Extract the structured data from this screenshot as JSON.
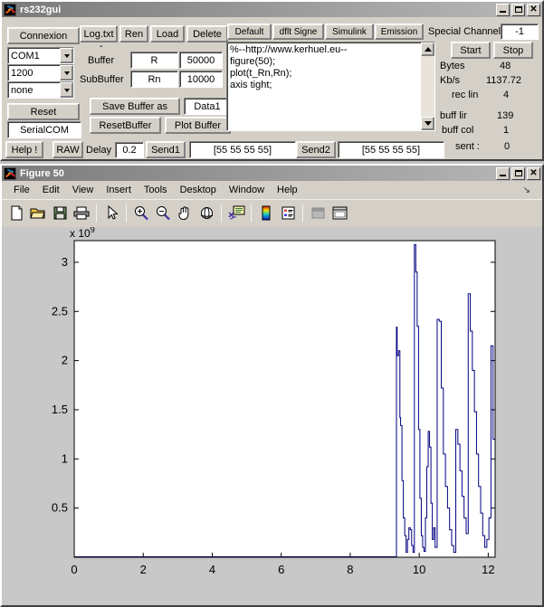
{
  "rs232": {
    "title": "rs232gui",
    "window_buttons": [
      "minimize",
      "maximize",
      "close"
    ],
    "connexion_button": "Connexion",
    "port_select": "COM1",
    "baud_select": "1200",
    "parity_select": "none",
    "reset_button": "Reset",
    "serial_name_field": "SerialCOM",
    "help_button": "Help !",
    "raw_button": "RAW",
    "delay_label": "Delay",
    "delay_value": "0.2",
    "log_button": "Log.txt",
    "ren_button": "Ren",
    "load_button": "Load",
    "delete_button": "Delete",
    "dash_label": "-",
    "buffer_label": "Buffer",
    "buffer_name": "R",
    "buffer_size": "50000",
    "subbuffer_label": "SubBuffer",
    "subbuffer_name": "Rn",
    "subbuffer_size": "10000",
    "save_buffer_button": "Save Buffer as",
    "save_buffer_name": "Data1",
    "reset_buffer_button": "ResetBuffer",
    "plot_buffer_button": "Plot Buffer",
    "send1_button": "Send1",
    "send1_value": "[55 55 55 55]",
    "send2_button": "Send2",
    "send2_value": "[55 55 55 55]",
    "default_button": "Default",
    "dflt_signe_button": "dflt Signe",
    "simulink_button": "Simulink",
    "emission_button": "Emission",
    "special_channel_label": "Special Channel",
    "special_channel_value": "-1",
    "code_lines": [
      "%--http://www.kerhuel.eu--",
      "figure(50);",
      "plot(t_Rn,Rn);",
      "axis tight;"
    ],
    "start_button": "Start",
    "stop_button": "Stop",
    "stats": [
      {
        "label": "Bytes",
        "value": "48"
      },
      {
        "label": "Kb/s",
        "value": "1137.72"
      },
      {
        "label": "rec lin",
        "value": "4"
      },
      {
        "label": "buff lir",
        "value": "139"
      },
      {
        "label": "buff col",
        "value": "1"
      },
      {
        "label": "sent :",
        "value": "0"
      }
    ]
  },
  "figure": {
    "title": "Figure 50",
    "menus": [
      "File",
      "Edit",
      "View",
      "Insert",
      "Tools",
      "Desktop",
      "Window",
      "Help"
    ],
    "toolbar_icons": [
      "new-figure-icon",
      "open-file-icon",
      "save-figure-icon",
      "print-figure-icon",
      "edit-plot-arrow-icon",
      "zoom-in-icon",
      "zoom-out-icon",
      "pan-icon",
      "rotate-3d-icon",
      "insert-colorbar-data-cursor-icon",
      "colorbar-icon",
      "legend-icon",
      "hide-plot-tools-icon",
      "show-plot-tools-icon"
    ],
    "dock_arrow": "dock-arrow-icon"
  },
  "chart_data": {
    "type": "line",
    "title": "",
    "xlabel": "",
    "ylabel": "",
    "y_exponent_label": "x 10",
    "y_exponent_sup": "9",
    "xlim": [
      0,
      12.2
    ],
    "ylim": [
      0,
      3.22
    ],
    "xticks": [
      0,
      2,
      4,
      6,
      8,
      10,
      12
    ],
    "xticklabels": [
      "0",
      "2",
      "4",
      "6",
      "8",
      "10",
      "12"
    ],
    "yticks": [
      0.5,
      1,
      1.5,
      2,
      2.5,
      3
    ],
    "yticklabels": [
      "0.5",
      "1",
      "1.5",
      "2",
      "2.5",
      "3"
    ],
    "grid": false,
    "legend": null,
    "line_color": "#000080",
    "series": [
      {
        "name": "Rn",
        "x": [
          0,
          9.32,
          9.34,
          9.36,
          9.4,
          9.44,
          9.46,
          9.5,
          9.54,
          9.58,
          9.62,
          9.66,
          9.7,
          9.74,
          9.78,
          9.82,
          9.86,
          9.9,
          9.94,
          9.98,
          10.02,
          10.06,
          10.1,
          10.14,
          10.18,
          10.22,
          10.26,
          10.3,
          10.34,
          10.38,
          10.42,
          10.46,
          10.52,
          10.58,
          10.64,
          10.7,
          10.76,
          10.82,
          10.88,
          10.94,
          11.0,
          11.06,
          11.12,
          11.18,
          11.24,
          11.3,
          11.36,
          11.42,
          11.48,
          11.54,
          11.6,
          11.66,
          11.72,
          11.78,
          11.84,
          11.9,
          11.96,
          12.02,
          12.08,
          12.14,
          12.2
        ],
        "y": [
          0.005,
          0.005,
          2.34,
          2.05,
          2.1,
          1.42,
          1.34,
          0.78,
          0.4,
          0.22,
          0.05,
          0.18,
          0.3,
          0.28,
          0.12,
          0.05,
          3.18,
          2.9,
          2.35,
          1.3,
          0.6,
          0.22,
          0.1,
          0.06,
          0.4,
          0.92,
          1.28,
          1.12,
          0.55,
          0.18,
          0.3,
          0.1,
          2.42,
          2.4,
          1.72,
          1.05,
          0.72,
          0.5,
          0.28,
          0.12,
          0.05,
          1.3,
          1.15,
          0.88,
          0.62,
          0.4,
          0.24,
          2.68,
          2.3,
          1.9,
          1.48,
          1.05,
          0.72,
          0.45,
          0.22,
          0.1,
          0.18,
          0.4,
          2.15,
          1.2,
          0.05
        ]
      }
    ]
  }
}
